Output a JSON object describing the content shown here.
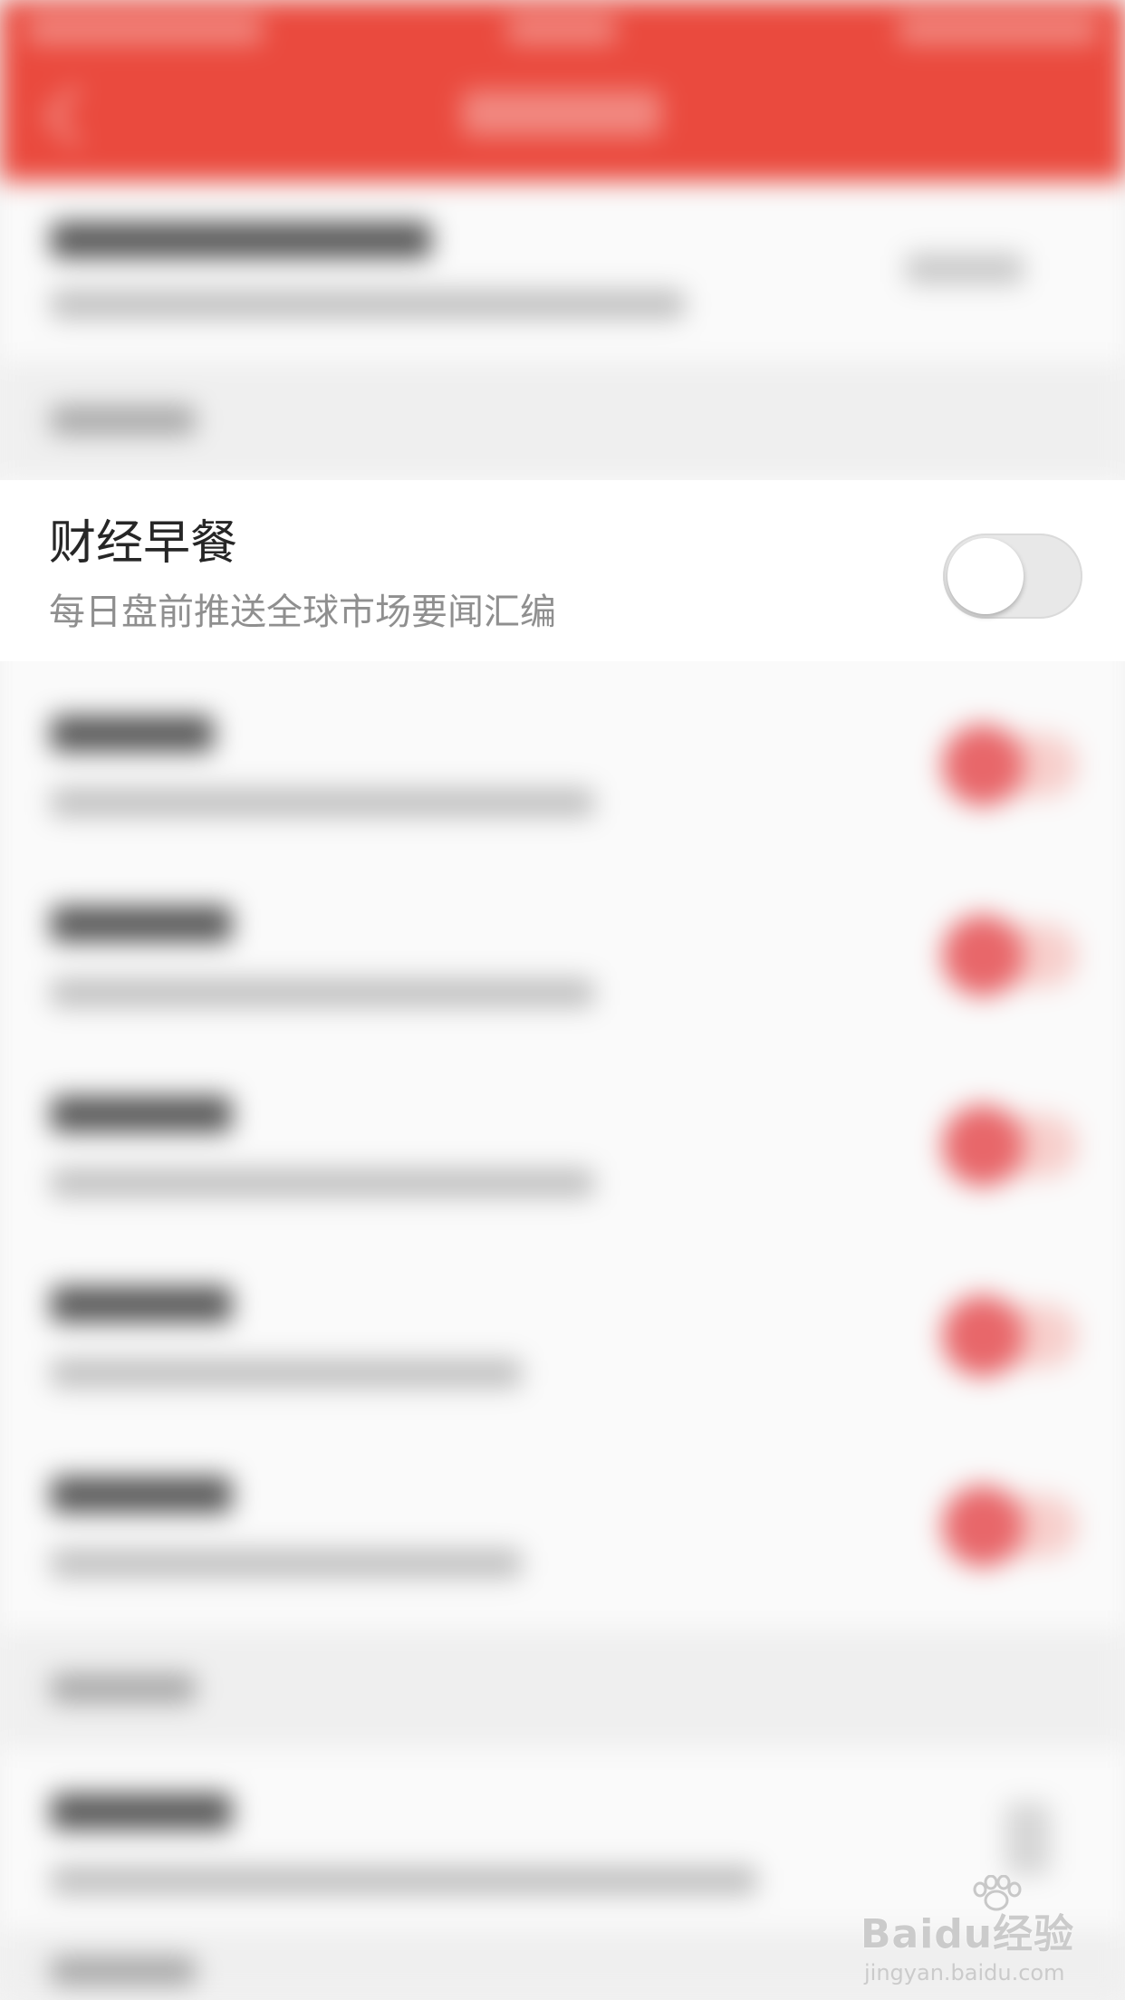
{
  "setting_item": {
    "title": "财经早餐",
    "subtitle": "每日盘前推送全球市场要闻汇编",
    "toggle_state": "off"
  },
  "watermark": {
    "brand_part1": "Bai",
    "brand_part2": "du",
    "brand_cn": "经验",
    "url": "jingyan.baidu.com"
  },
  "colors": {
    "header_red": "#ea4a3e",
    "toggle_on_red": "#e8676a",
    "toggle_off_track": "#e8e8e8",
    "title_text": "#262626",
    "subtitle_text": "#8f8f8f"
  }
}
